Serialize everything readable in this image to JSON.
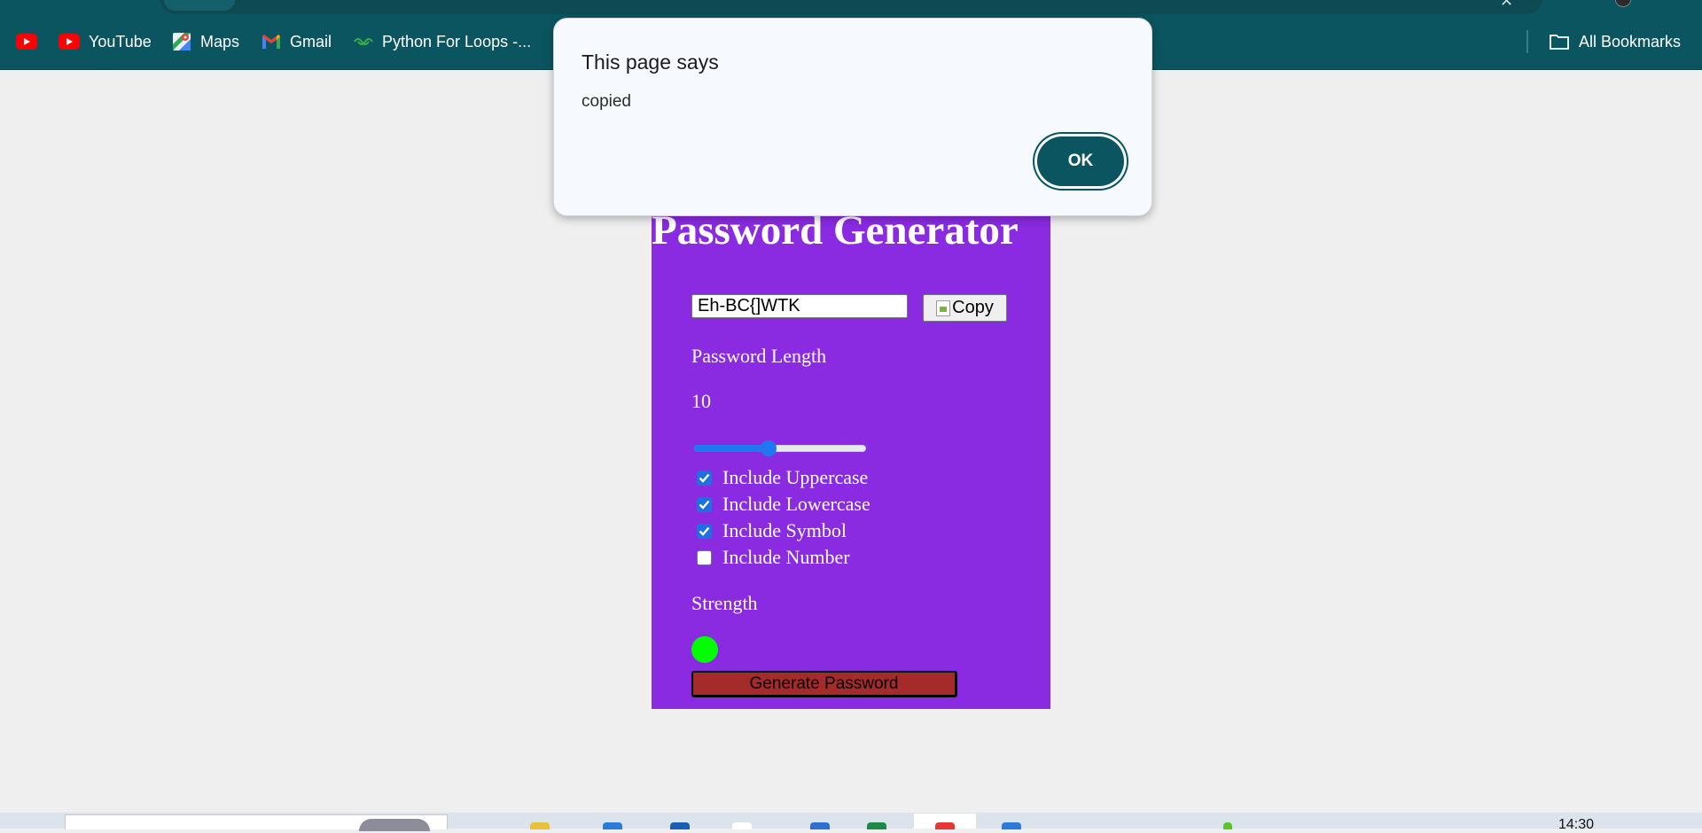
{
  "browser": {
    "bookmarks": [
      {
        "label": "",
        "icon": "youtube-icon"
      },
      {
        "label": "YouTube",
        "icon": "youtube-icon"
      },
      {
        "label": "Maps",
        "icon": "maps-icon"
      },
      {
        "label": "Gmail",
        "icon": "gmail-icon"
      },
      {
        "label": "Python For Loops -...",
        "icon": "w3schools-icon"
      }
    ],
    "all_bookmarks_label": "All Bookmarks",
    "accent": "#0b5560"
  },
  "page": {
    "title": "Password Generator",
    "password_value": "Eh-BC{]WTK",
    "copy_label": "Copy",
    "length_label": "Password Length",
    "length_value": "10",
    "slider_fraction": 0.4,
    "options": [
      {
        "label": "Include Uppercase",
        "checked": true
      },
      {
        "label": "Include Lowercase",
        "checked": true
      },
      {
        "label": "Include Symbol",
        "checked": true
      },
      {
        "label": "Include Number",
        "checked": false
      }
    ],
    "strength_label": "Strength",
    "strength_color": "#00ff00",
    "generate_label": "Generate Password",
    "card_color": "#8a2be2"
  },
  "dialog": {
    "title": "This page says",
    "message": "copied",
    "ok_label": "OK"
  },
  "taskbar": {
    "time": "14:30"
  }
}
